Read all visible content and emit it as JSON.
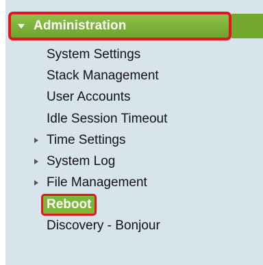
{
  "nav": {
    "header": {
      "label": "Administration"
    },
    "items": [
      {
        "label": "System Settings",
        "expandable": false,
        "selected": false
      },
      {
        "label": "Stack Management",
        "expandable": false,
        "selected": false
      },
      {
        "label": "User Accounts",
        "expandable": false,
        "selected": false
      },
      {
        "label": "Idle Session Timeout",
        "expandable": false,
        "selected": false
      },
      {
        "label": "Time Settings",
        "expandable": true,
        "selected": false
      },
      {
        "label": "System Log",
        "expandable": true,
        "selected": false
      },
      {
        "label": "File Management",
        "expandable": true,
        "selected": false
      },
      {
        "label": "Reboot",
        "expandable": false,
        "selected": true
      },
      {
        "label": "Discovery - Bonjour",
        "expandable": false,
        "selected": false
      }
    ]
  },
  "colors": {
    "panel_bg": "#d7e4ec",
    "header_green": "#7ab83a",
    "highlight_red": "#e3151f",
    "text": "#111111"
  }
}
